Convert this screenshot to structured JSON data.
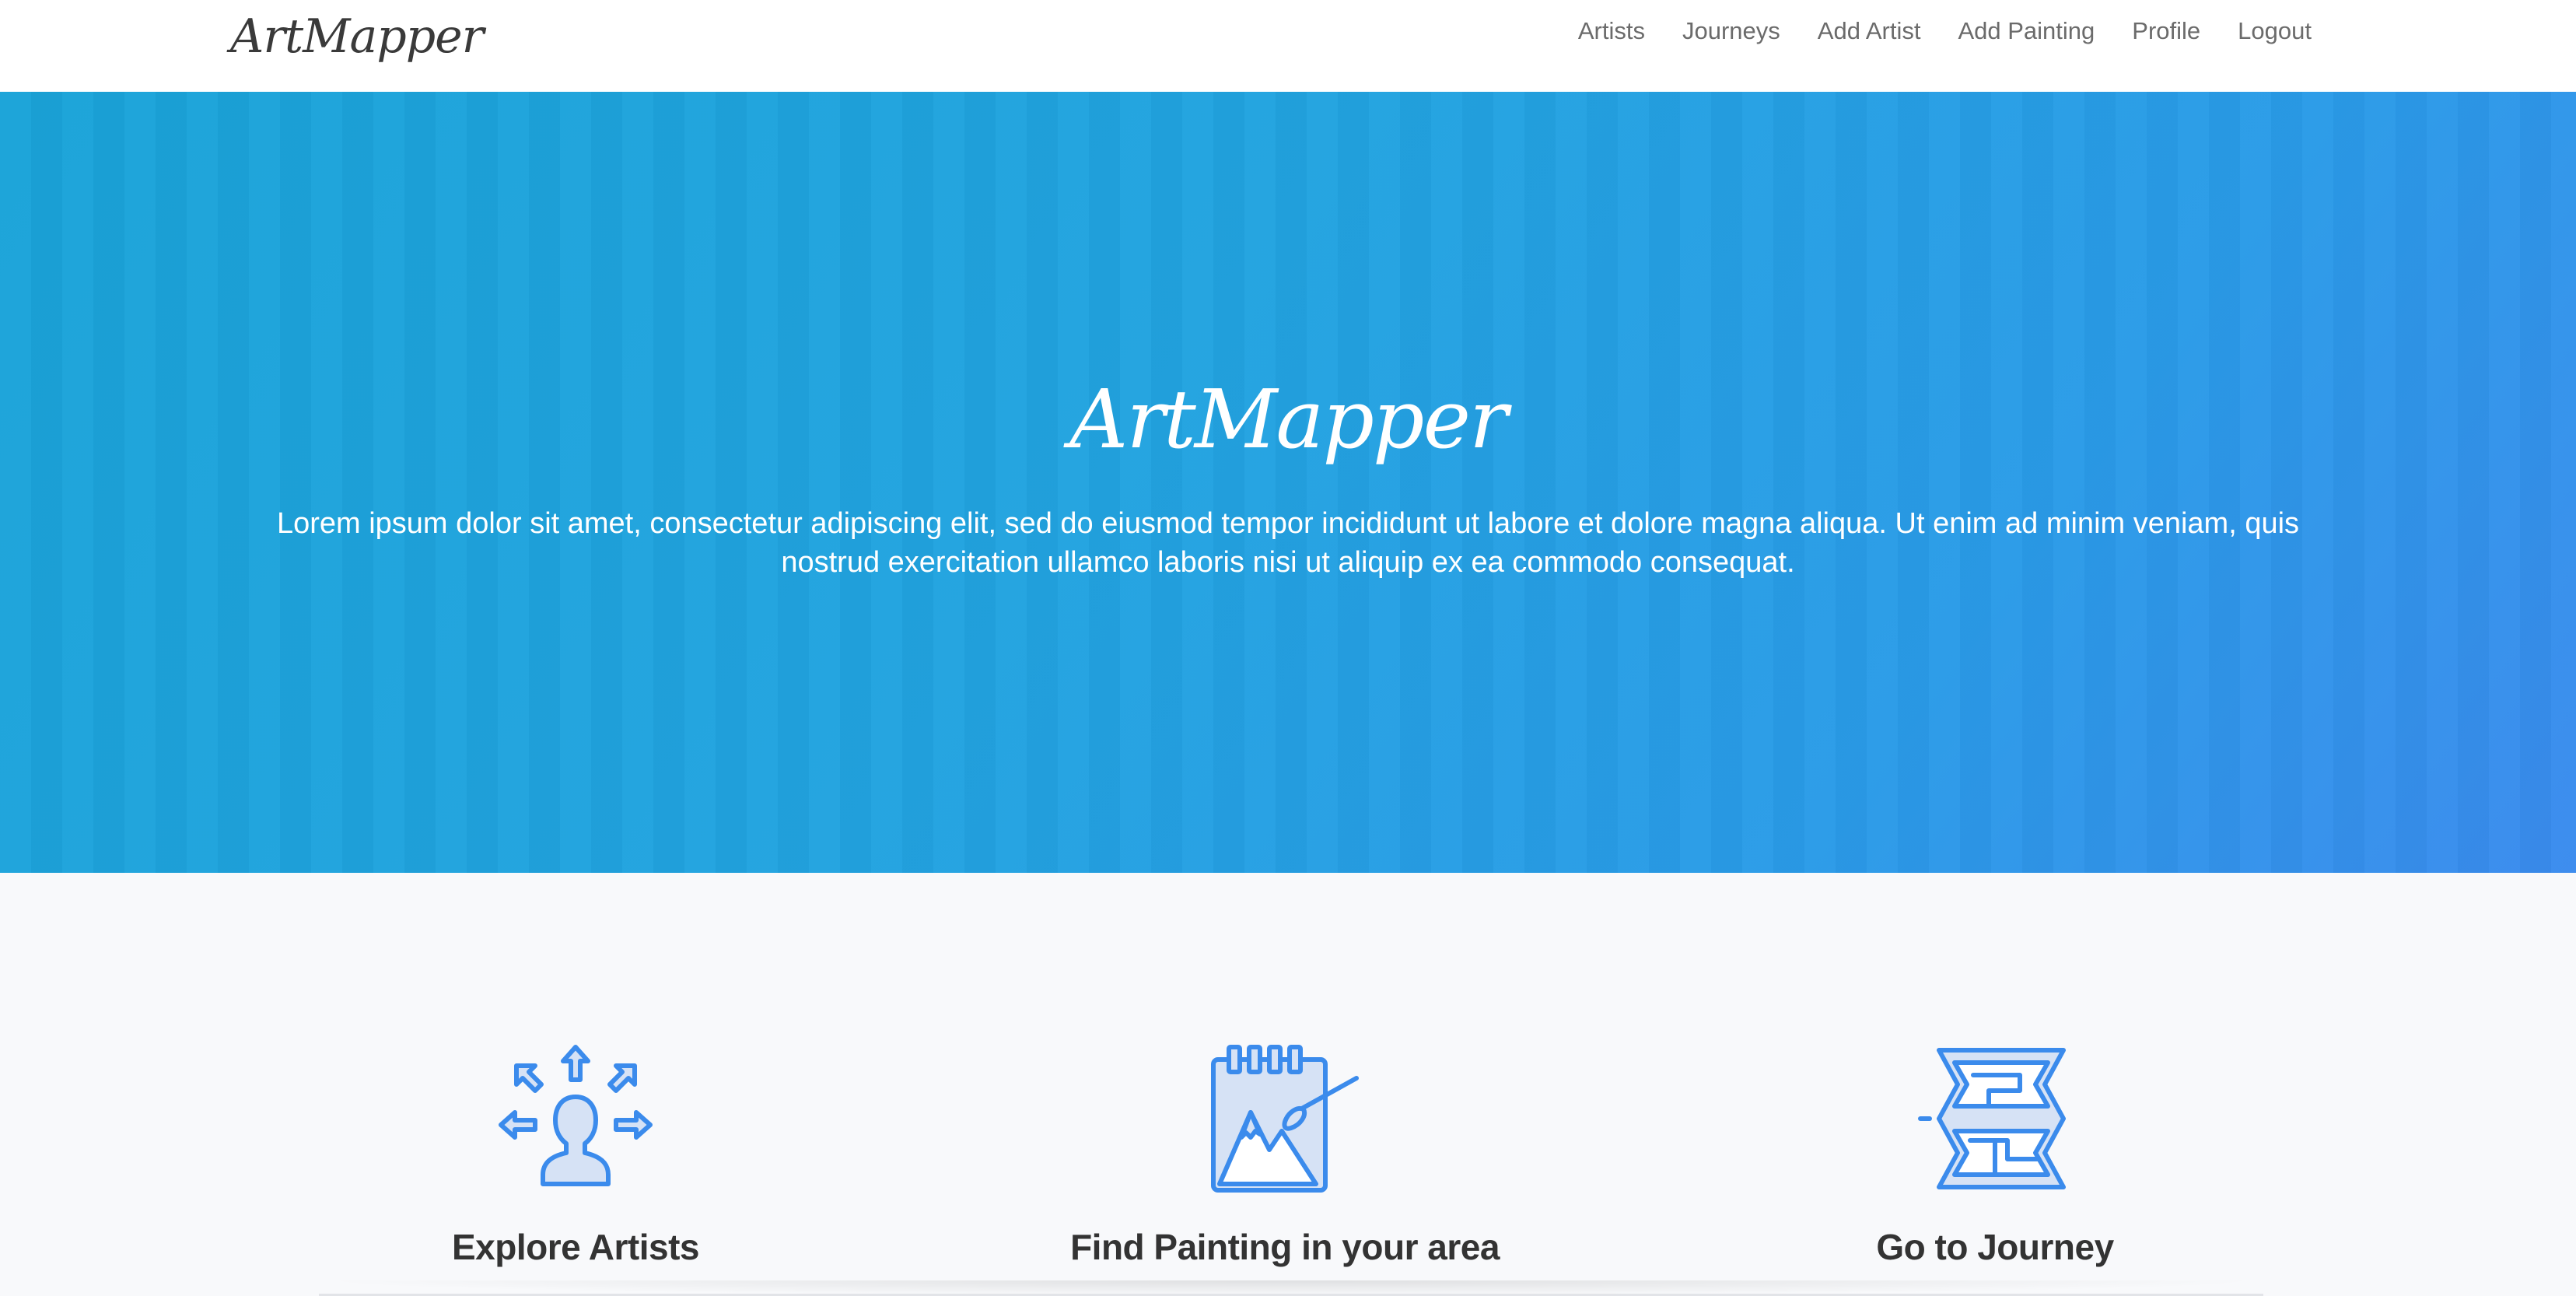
{
  "brand": "ArtMapper",
  "nav": {
    "artists": "Artists",
    "journeys": "Journeys",
    "add_artist": "Add Artist",
    "add_painting": "Add Painting",
    "profile": "Profile",
    "logout": "Logout"
  },
  "hero": {
    "title": "ArtMapper",
    "text": "Lorem ipsum dolor sit amet, consectetur adipiscing elit, sed do eiusmod tempor incididunt ut labore et dolore magna aliqua. Ut enim ad minim veniam, quis nostrud exercitation ullamco laboris nisi ut aliquip ex ea commodo consequat."
  },
  "features": [
    {
      "title": "Explore Artists",
      "icon": "person-arrows-icon"
    },
    {
      "title": "Find Painting in your area",
      "icon": "sketchbook-painting-icon"
    },
    {
      "title": "Go to Journey",
      "icon": "folded-map-icon"
    }
  ],
  "colors": {
    "accent": "#3b8bec",
    "icon_fill": "#d6e2f5",
    "hero_start": "#1aa3d8",
    "hero_end": "#3a8bee"
  }
}
